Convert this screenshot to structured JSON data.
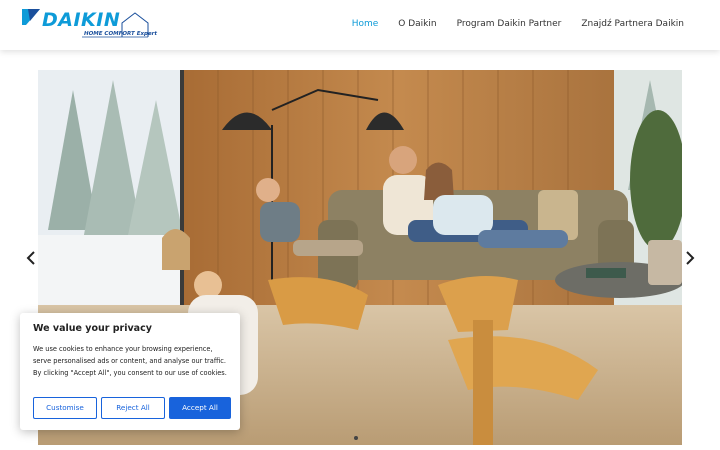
{
  "brand": {
    "name": "DAIKIN",
    "tagline": "HOME COMFORT Expert",
    "color": "#0e9bd8",
    "icons": [
      "daikin-logo-icon",
      "house-outline-icon"
    ]
  },
  "nav": {
    "items": [
      {
        "label": "Home",
        "active": true
      },
      {
        "label": "O Daikin",
        "active": false
      },
      {
        "label": "Program Daikin Partner",
        "active": false
      },
      {
        "label": "Znajdź Partnera Daikin",
        "active": false
      }
    ]
  },
  "hero": {
    "slide_indicator": 1,
    "arrows": [
      "chevron-left-icon",
      "chevron-right-icon"
    ]
  },
  "cookie": {
    "title": "We value your privacy",
    "text": "We use cookies to enhance your browsing experience, serve personalised ads or content, and analyse our traffic. By clicking \"Accept All\", you consent to our use of cookies.",
    "customise": "Customise",
    "reject": "Reject All",
    "accept": "Accept All",
    "accent": "#1863dc"
  }
}
